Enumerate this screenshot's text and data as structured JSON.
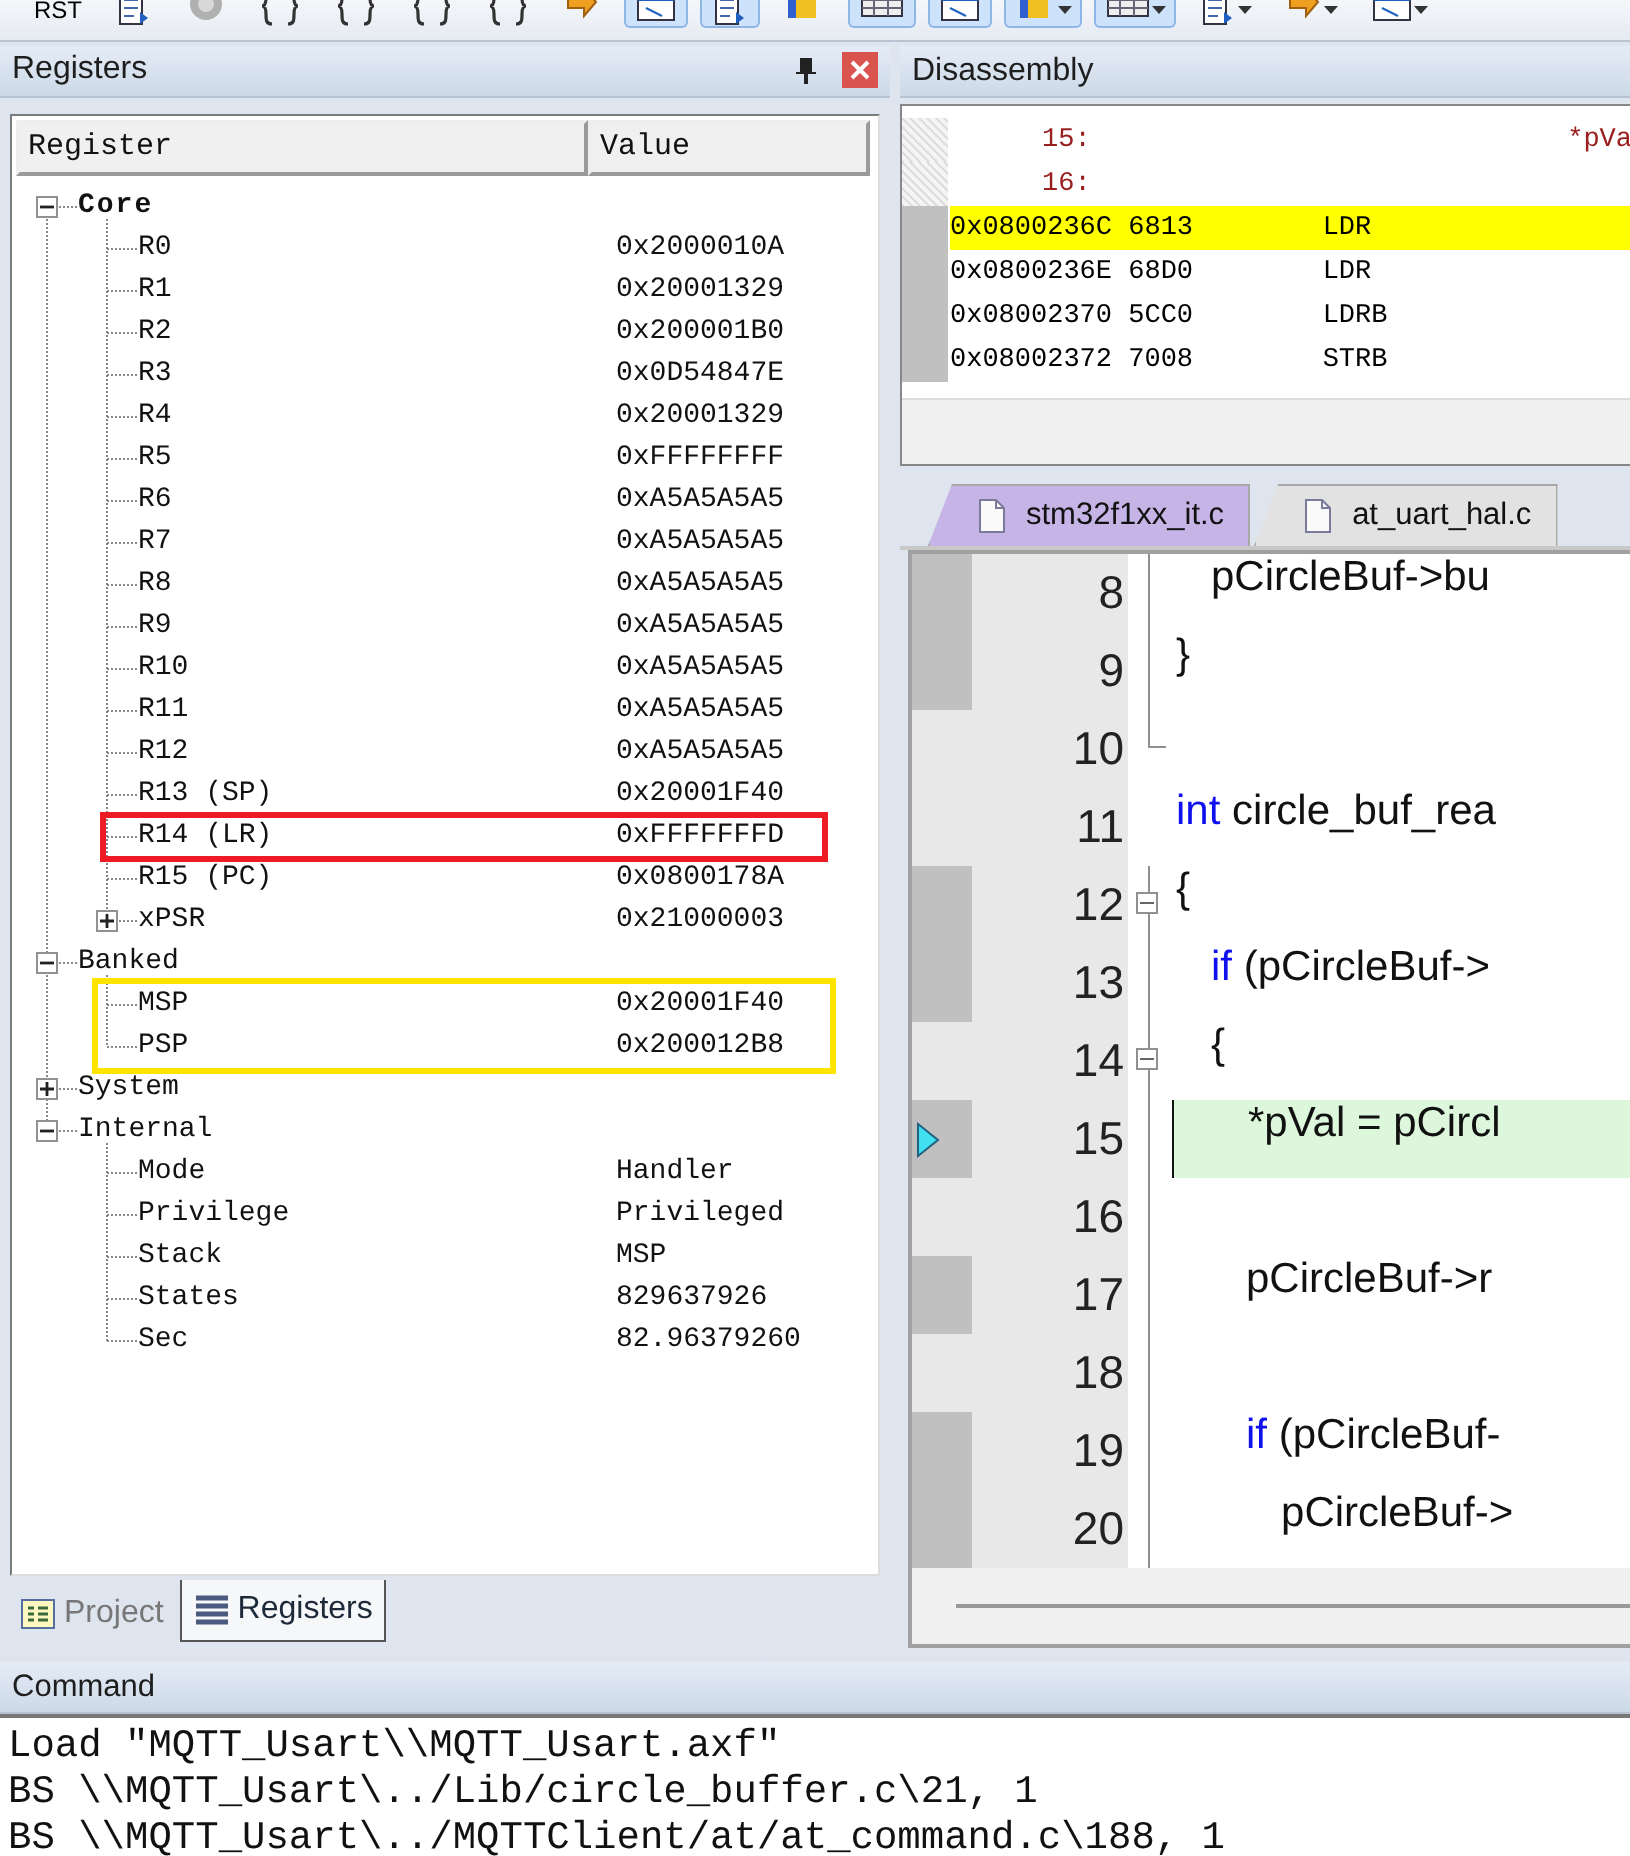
{
  "toolbar": {
    "buttons": [
      {
        "kind": "text",
        "label": "RST",
        "pressed": false,
        "menu": false
      },
      {
        "kind": "icon",
        "pressed": false,
        "menu": false
      },
      {
        "kind": "icon",
        "pressed": false,
        "menu": false
      },
      {
        "kind": "icon",
        "pressed": false,
        "menu": false
      },
      {
        "kind": "icon",
        "pressed": false,
        "menu": false
      },
      {
        "kind": "icon",
        "pressed": false,
        "menu": false
      },
      {
        "kind": "icon",
        "pressed": false,
        "menu": false
      },
      {
        "kind": "icon",
        "pressed": false,
        "menu": false
      },
      {
        "kind": "icon",
        "pressed": true,
        "menu": false
      },
      {
        "kind": "icon",
        "pressed": true,
        "menu": false
      },
      {
        "kind": "icon",
        "pressed": false,
        "menu": false
      },
      {
        "kind": "icon",
        "pressed": true,
        "menu": false
      },
      {
        "kind": "icon",
        "pressed": true,
        "menu": false
      },
      {
        "kind": "icon",
        "pressed": true,
        "menu": true
      },
      {
        "kind": "icon",
        "pressed": true,
        "menu": true
      },
      {
        "kind": "icon",
        "pressed": false,
        "menu": true
      },
      {
        "kind": "icon",
        "pressed": false,
        "menu": true
      },
      {
        "kind": "icon",
        "pressed": false,
        "menu": true
      }
    ]
  },
  "registers": {
    "title": "Registers",
    "columns": [
      "Register",
      "Value"
    ],
    "groups": [
      {
        "name": "Core",
        "expanded": true,
        "bold": true,
        "items": [
          {
            "name": "R0",
            "value": "0x2000010A"
          },
          {
            "name": "R1",
            "value": "0x20001329"
          },
          {
            "name": "R2",
            "value": "0x200001B0"
          },
          {
            "name": "R3",
            "value": "0x0D54847E"
          },
          {
            "name": "R4",
            "value": "0x20001329"
          },
          {
            "name": "R5",
            "value": "0xFFFFFFFF"
          },
          {
            "name": "R6",
            "value": "0xA5A5A5A5"
          },
          {
            "name": "R7",
            "value": "0xA5A5A5A5"
          },
          {
            "name": "R8",
            "value": "0xA5A5A5A5"
          },
          {
            "name": "R9",
            "value": "0xA5A5A5A5"
          },
          {
            "name": "R10",
            "value": "0xA5A5A5A5"
          },
          {
            "name": "R11",
            "value": "0xA5A5A5A5"
          },
          {
            "name": "R12",
            "value": "0xA5A5A5A5"
          },
          {
            "name": "R13 (SP)",
            "value": "0x20001F40"
          },
          {
            "name": "R14 (LR)",
            "value": "0xFFFFFFFD",
            "color": "#ed1c24"
          },
          {
            "name": "R15 (PC)",
            "value": "0x0800178A"
          },
          {
            "name": "xPSR",
            "value": "0x21000003",
            "expanded": false
          }
        ]
      },
      {
        "name": "Banked",
        "expanded": true,
        "bold": false,
        "items": [
          {
            "name": "MSP",
            "value": "0x20001F40",
            "color": "#ffe400"
          },
          {
            "name": "PSP",
            "value": "0x200012B8",
            "color": "#ffe400"
          }
        ]
      },
      {
        "name": "System",
        "expanded": false,
        "bold": false
      },
      {
        "name": "Internal",
        "expanded": true,
        "bold": false,
        "items": [
          {
            "name": "Mode",
            "value": "Handler"
          },
          {
            "name": "Privilege",
            "value": "Privileged"
          },
          {
            "name": "Stack",
            "value": "MSP"
          },
          {
            "name": "States",
            "value": "829637926"
          },
          {
            "name": "Sec",
            "value": "82.96379260"
          }
        ]
      }
    ],
    "tabs": [
      {
        "label": "Project",
        "selected": false
      },
      {
        "label": "Registers",
        "selected": true
      }
    ]
  },
  "disassembly": {
    "title": "Disassembly",
    "lines": [
      {
        "kind": "source",
        "line": "15:",
        "text": "*pVa"
      },
      {
        "kind": "source",
        "line": "16:"
      },
      {
        "kind": "instruction",
        "address": "0x0800236C",
        "opcode": "6813",
        "mnemonic": "LDR",
        "current": true
      },
      {
        "kind": "instruction",
        "address": "0x0800236E",
        "opcode": "68D0",
        "mnemonic": "LDR",
        "current": false
      },
      {
        "kind": "instruction",
        "address": "0x08002370",
        "opcode": "5CC0",
        "mnemonic": "LDRB",
        "current": false
      },
      {
        "kind": "instruction",
        "address": "0x08002372",
        "opcode": "7008",
        "mnemonic": "STRB",
        "current": false
      }
    ]
  },
  "editor": {
    "tabs": [
      {
        "label": "stm32f1xx_it.c",
        "selected": true
      },
      {
        "label": "at_uart_hal.c",
        "selected": false
      }
    ],
    "lines": [
      {
        "number": "8",
        "executable": true,
        "current": false,
        "collapsible": false,
        "code": [
          {
            "kind": "plain",
            "text": "   pCircleBuf->bu"
          }
        ]
      },
      {
        "number": "9",
        "executable": true,
        "current": false,
        "collapsible": false,
        "code": [
          {
            "kind": "plain",
            "text": "}"
          }
        ]
      },
      {
        "number": "10",
        "executable": false,
        "current": false,
        "collapsible": false
      },
      {
        "number": "11",
        "executable": false,
        "current": false,
        "collapsible": false,
        "code": [
          {
            "kind": "keyword",
            "text": "int"
          },
          {
            "kind": "plain",
            "text": " circle_buf_rea"
          }
        ]
      },
      {
        "number": "12",
        "executable": true,
        "current": false,
        "collapsible": true,
        "code": [
          {
            "kind": "plain",
            "text": "{"
          }
        ]
      },
      {
        "number": "13",
        "executable": true,
        "current": false,
        "collapsible": false,
        "code": [
          {
            "kind": "keyword",
            "text": "   if"
          },
          {
            "kind": "plain",
            "text": " (pCircleBuf->"
          }
        ]
      },
      {
        "number": "14",
        "executable": false,
        "current": false,
        "collapsible": true,
        "code": [
          {
            "kind": "plain",
            "text": "   {"
          }
        ]
      },
      {
        "number": "15",
        "executable": true,
        "current": true,
        "collapsible": false,
        "code": [
          {
            "kind": "plain",
            "text": "      *pVal = pCircl"
          }
        ]
      },
      {
        "number": "16",
        "executable": false,
        "current": false,
        "collapsible": false
      },
      {
        "number": "17",
        "executable": true,
        "current": false,
        "collapsible": false,
        "code": [
          {
            "kind": "plain",
            "text": "      pCircleBuf->r"
          }
        ]
      },
      {
        "number": "18",
        "executable": false,
        "current": false,
        "collapsible": false
      },
      {
        "number": "19",
        "executable": true,
        "current": false,
        "collapsible": false,
        "code": [
          {
            "kind": "keyword",
            "text": "      if"
          },
          {
            "kind": "plain",
            "text": " (pCircleBuf-"
          }
        ]
      },
      {
        "number": "20",
        "executable": true,
        "current": false,
        "collapsible": false,
        "code": [
          {
            "kind": "plain",
            "text": "         pCircleBuf->"
          }
        ]
      }
    ]
  },
  "command": {
    "title": "Command",
    "lines": [
      "Load \"MQTT_Usart\\\\MQTT_Usart.axf\"",
      "BS \\\\MQTT_Usart\\../Lib/circle_buffer.c\\21, 1",
      "BS \\\\MQTT_Usart\\../MQTTClient/at/at_command.c\\188, 1"
    ]
  }
}
